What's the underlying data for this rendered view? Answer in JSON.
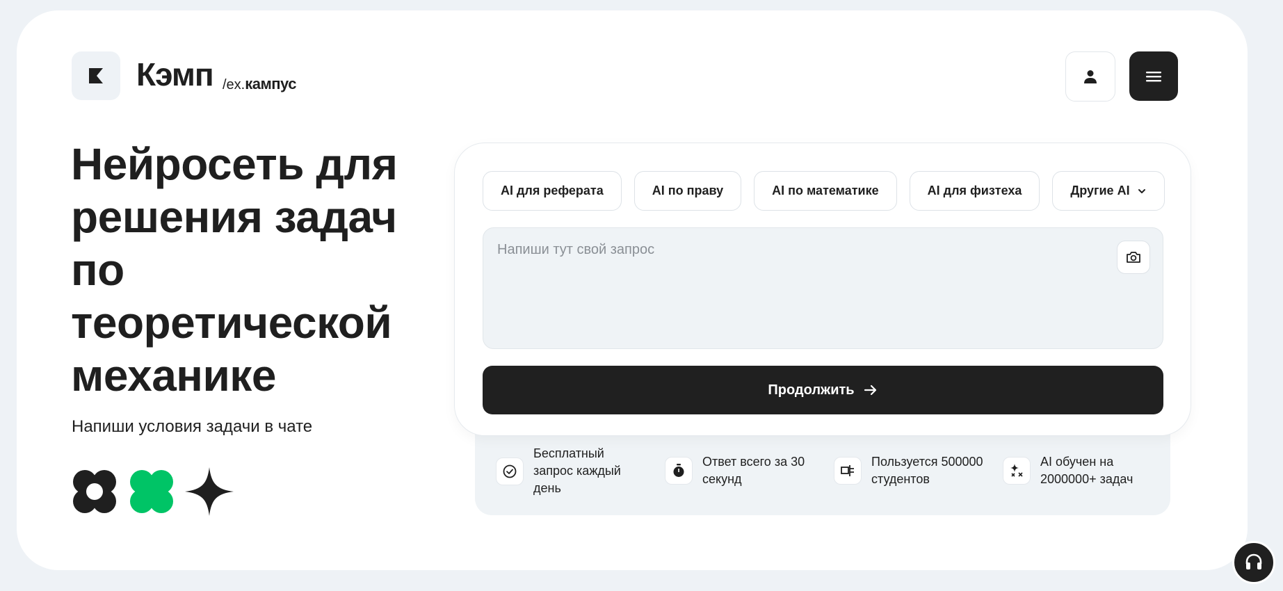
{
  "header": {
    "brand_name": "Кэмп",
    "brand_ex_prefix": "/ex.",
    "brand_ex_name": "кампус"
  },
  "hero": {
    "title": "Нейросеть для решения задач по теоретической механике",
    "subtitle": "Напиши условия задачи в чате"
  },
  "panel": {
    "chips": [
      {
        "label": "AI для реферата"
      },
      {
        "label": "AI по праву"
      },
      {
        "label": "AI по математике"
      },
      {
        "label": "AI для физтеха"
      },
      {
        "label": "Другие AI"
      }
    ],
    "prompt_placeholder": "Напиши тут свой запрос",
    "prompt_value": "",
    "continue_label": "Продолжить"
  },
  "features": [
    {
      "icon": "check-badge-icon",
      "text": "Бесплатный запрос каждый день"
    },
    {
      "icon": "stopwatch-icon",
      "text": "Ответ всего за 30 секунд"
    },
    {
      "icon": "users-board-icon",
      "text": "Пользуется 500000 студентов"
    },
    {
      "icon": "sparkles-icon",
      "text": "AI обучен на 2000000+ задач"
    }
  ],
  "colors": {
    "accent_green": "#00c466",
    "dark": "#202020",
    "page_bg": "#eef2f6"
  }
}
